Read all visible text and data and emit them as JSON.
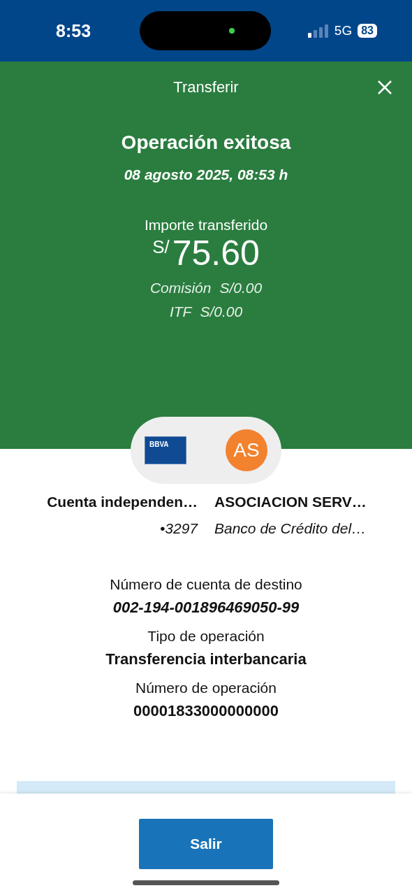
{
  "status_bar": {
    "time": "8:53",
    "network": "5G",
    "battery": "83"
  },
  "header": {
    "title": "Transferir"
  },
  "result": {
    "title": "Operación exitosa",
    "date": "08 agosto 2025, 08:53 h",
    "amount_label": "Importe transferido",
    "currency": "S/",
    "amount": "75.60",
    "fees": [
      {
        "label": "Comisión",
        "value": "S/0.00"
      },
      {
        "label": "ITF",
        "value": "S/0.00"
      }
    ]
  },
  "parties": {
    "origin_card_brand": "BBVA",
    "destination_initials": "AS",
    "origin": {
      "name": "Cuenta independen…",
      "detail": "•3297"
    },
    "destination": {
      "name": "ASOCIACION SERV…",
      "detail": "Banco de Crédito del…"
    }
  },
  "details": [
    {
      "label": "Número de cuenta de destino",
      "value": "002-194-001896469050-99",
      "italic": true
    },
    {
      "label": "Tipo de operación",
      "value": "Transferencia interbancaria",
      "italic": false
    },
    {
      "label": "Número de operación",
      "value": "00001833000000000",
      "italic": false
    }
  ],
  "footer": {
    "button": "Salir"
  }
}
